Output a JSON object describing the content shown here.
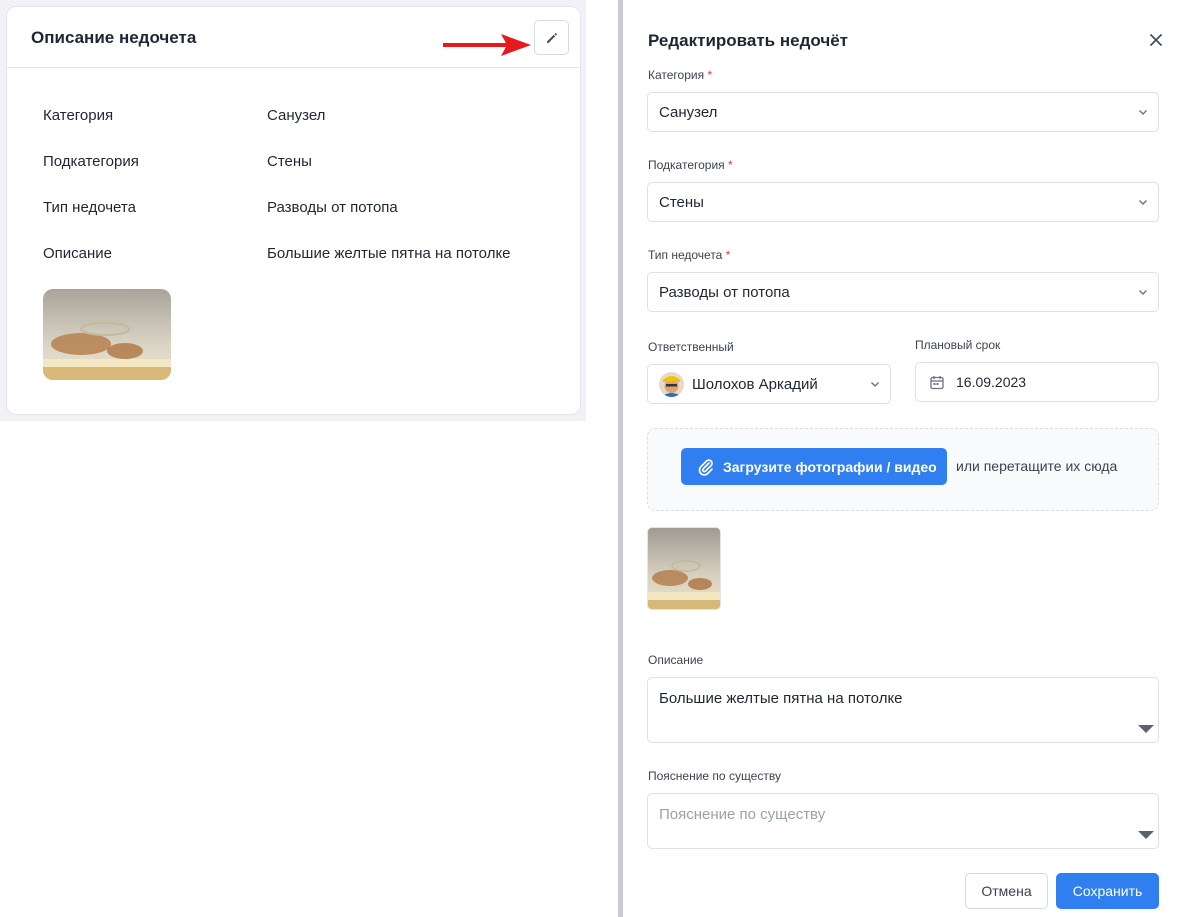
{
  "defect_card": {
    "title": "Описание недочета",
    "rows": [
      {
        "label": "Категория",
        "value": "Санузел"
      },
      {
        "label": "Подкатегория",
        "value": "Стены"
      },
      {
        "label": "Тип недочета",
        "value": "Разводы от потопа"
      },
      {
        "label": "Описание",
        "value": "Большие желтые пятна на потолке"
      }
    ]
  },
  "edit_modal": {
    "title": "Редактировать недочёт",
    "category": {
      "label": "Категория",
      "required": "*",
      "value": "Санузел"
    },
    "subcategory": {
      "label": "Подкатегория",
      "required": "*",
      "value": "Стены"
    },
    "defect_type": {
      "label": "Тип недочета",
      "required": "*",
      "value": "Разводы от потопа"
    },
    "responsible": {
      "label": "Ответственный",
      "value": "Шолохов Аркадий"
    },
    "due_date": {
      "label": "Плановый срок",
      "value": "16.09.2023"
    },
    "upload": {
      "button_label": "Загрузите фотографии / видео",
      "hint": "или перетащите их сюда"
    },
    "description": {
      "label": "Описание",
      "value": "Большие желтые пятна на потолке"
    },
    "explanation": {
      "label": "Пояснение по существу",
      "placeholder": "Пояснение по существу"
    },
    "cancel_label": "Отмена",
    "save_label": "Сохранить"
  },
  "colors": {
    "accent": "#2f7ff0",
    "required": "#e53935",
    "arrow": "#e8191c"
  }
}
